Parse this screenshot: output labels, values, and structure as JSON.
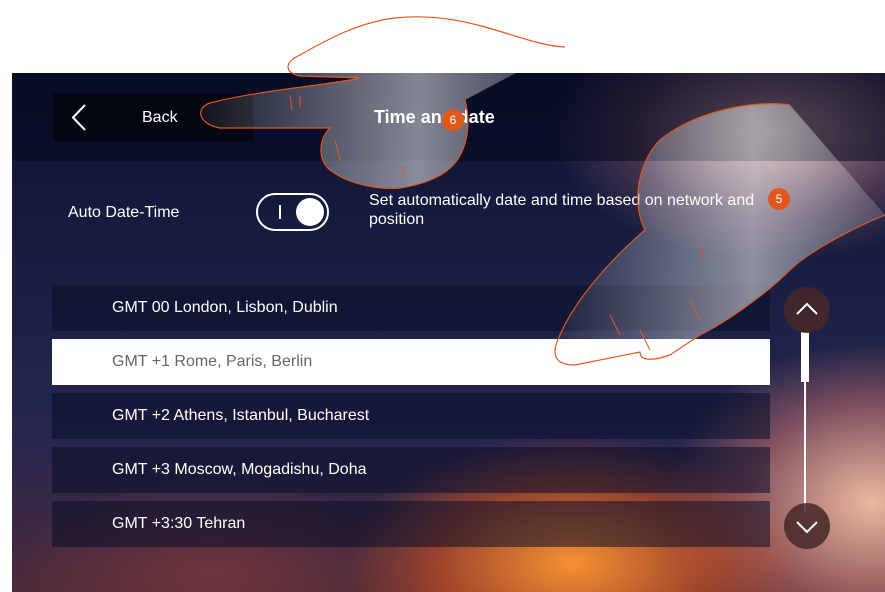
{
  "header": {
    "back_label": "Back",
    "title": "Time and date"
  },
  "auto_datetime": {
    "label": "Auto Date-Time",
    "enabled": true,
    "description": "Set automatically date and time based on network and position"
  },
  "timezones": [
    {
      "label": "GMT 00 London, Lisbon, Dublin",
      "selected": false
    },
    {
      "label": "GMT +1 Rome, Paris, Berlin",
      "selected": true
    },
    {
      "label": "GMT +2 Athens, Istanbul, Bucharest",
      "selected": false
    },
    {
      "label": "GMT +3 Moscow, Mogadishu, Doha",
      "selected": false
    },
    {
      "label": "GMT +3:30 Tehran",
      "selected": false
    }
  ],
  "callouts": {
    "badge_6": "6",
    "badge_5": "5"
  },
  "colors": {
    "accent_badge": "#e2571e",
    "selected_row": "#ffffff"
  }
}
